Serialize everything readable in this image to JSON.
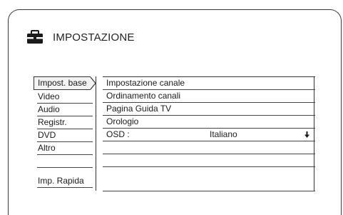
{
  "header": {
    "icon": "toolbox-icon",
    "title": "IMPOSTAZIONE"
  },
  "menu": {
    "selected_index": 0,
    "items": [
      {
        "label": "Impost. base"
      },
      {
        "label": "Video"
      },
      {
        "label": "Audio"
      },
      {
        "label": "Registr."
      },
      {
        "label": "DVD"
      },
      {
        "label": "Altro"
      },
      {
        "label": ""
      },
      {
        "label": "Imp. Rapida"
      }
    ]
  },
  "options": {
    "rows": [
      {
        "label": "Impostazione canale"
      },
      {
        "label": "Ordinamento canali"
      },
      {
        "label": "Pagina Guida TV"
      },
      {
        "label": "Orologio"
      },
      {
        "label": "OSD :",
        "value": "Italiano",
        "icon": "arrow-down-icon"
      },
      {
        "label": ""
      },
      {
        "label": ""
      },
      {
        "label": ""
      }
    ]
  }
}
